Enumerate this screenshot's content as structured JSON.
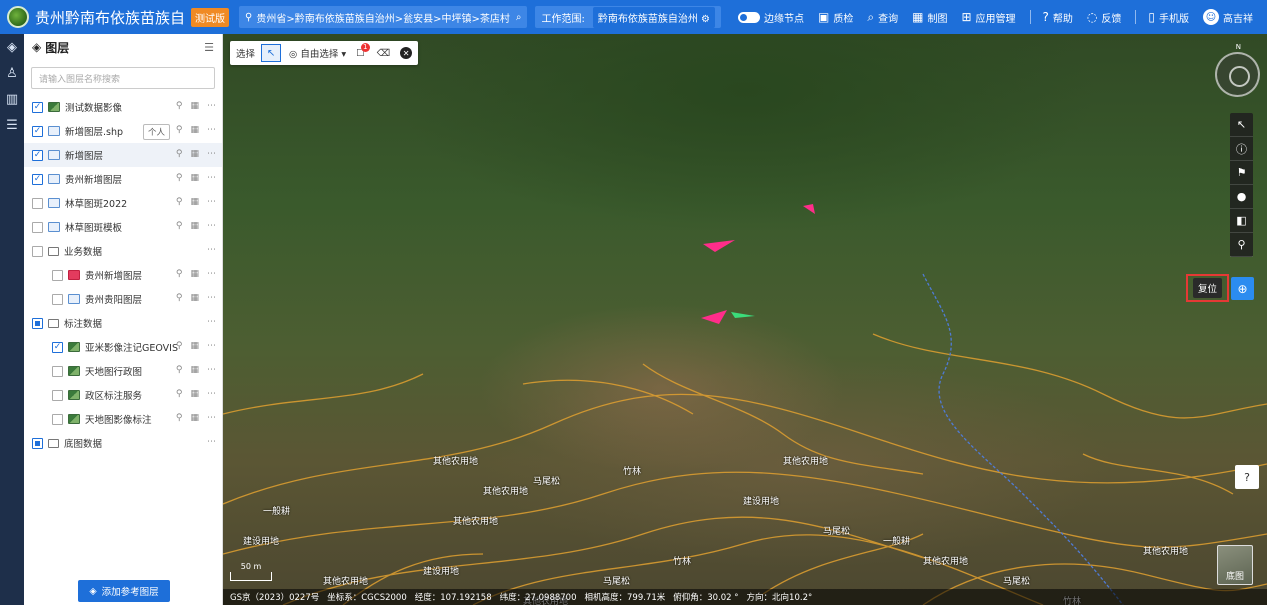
{
  "header": {
    "app_title": "贵州黔南布依族苗族自",
    "version_tag": "测试版",
    "breadcrumb": "贵州省>黔南布依族苗族自治州>瓮安县>中坪镇>茶店村",
    "scope_label": "工作范围:",
    "scope_value": "黔南布依族苗族自治州",
    "nav": [
      {
        "icon": "toggle-icon",
        "label": "边缘节点"
      },
      {
        "icon": "quality-check-icon",
        "label": "质检"
      },
      {
        "icon": "search-icon",
        "label": "查询"
      },
      {
        "icon": "map-draw-icon",
        "label": "制图"
      },
      {
        "icon": "grid-apps-icon",
        "label": "应用管理"
      },
      {
        "icon": "help-icon",
        "label": "帮助"
      },
      {
        "icon": "feedback-icon",
        "label": "反馈"
      },
      {
        "icon": "mobile-icon",
        "label": "手机版"
      }
    ],
    "user_name": "高吉祥"
  },
  "panel": {
    "title": "图层",
    "search_placeholder": "请输入图层名称搜索",
    "personal_badge": "个人",
    "add_button": "添加参考图层",
    "layers": [
      {
        "name": "测试数据影像",
        "checked": true,
        "icon": "image-layer-icon",
        "indent": 0
      },
      {
        "name": "新增图层.shp",
        "checked": true,
        "icon": "vector-layer-icon",
        "indent": 0
      },
      {
        "name": "新增图层",
        "checked": true,
        "icon": "vector-layer-icon",
        "indent": 0
      },
      {
        "name": "贵州新增图层",
        "checked": true,
        "icon": "vector-layer-icon",
        "indent": 0
      },
      {
        "name": "林草图斑2022",
        "checked": false,
        "icon": "vector-layer-icon",
        "indent": 0
      },
      {
        "name": "林草图斑模板",
        "checked": false,
        "icon": "vector-layer-icon",
        "indent": 0
      },
      {
        "name": "业务数据",
        "checked": false,
        "icon": "folder-icon",
        "indent": 0
      },
      {
        "name": "贵州新增图层",
        "checked": false,
        "icon": "red-layer-icon",
        "indent": 1
      },
      {
        "name": "贵州贵阳图层",
        "checked": false,
        "icon": "vector-layer-icon",
        "indent": 1
      },
      {
        "name": "标注数据",
        "checked": "partial",
        "icon": "folder-icon",
        "indent": 0
      },
      {
        "name": "亚米影像注记GEOVIS",
        "checked": true,
        "icon": "image-layer-icon",
        "indent": 1
      },
      {
        "name": "天地图行政图",
        "checked": false,
        "icon": "image-layer-icon",
        "indent": 1
      },
      {
        "name": "政区标注服务",
        "checked": false,
        "icon": "image-layer-icon",
        "indent": 1
      },
      {
        "name": "天地图影像标注",
        "checked": false,
        "icon": "image-layer-icon",
        "indent": 1
      },
      {
        "name": "底图数据",
        "checked": "partial",
        "icon": "folder-icon",
        "indent": 0
      }
    ]
  },
  "map_toolbar": {
    "select_label": "选择",
    "free_select_label": "自由选择",
    "notification_count": "1"
  },
  "map": {
    "reset_label": "复位",
    "basemap_label": "底图",
    "compass_n": "N",
    "scale_label": "50 m",
    "status": {
      "copyright": "GS京（2023）0227号",
      "crs": "坐标系：CGCS2000",
      "lon": "经度：107.192158",
      "lat": "纬度：27.0988700",
      "cam_height": "相机高度：799.71米",
      "pitch": "俯仰角：30.02 °",
      "heading": "方向：北向10.2°"
    },
    "labels": [
      "其他农用地",
      "其他农用地",
      "其他农用地",
      "建设用地",
      "一般耕",
      "马尾松",
      "竹林",
      "建设用地",
      "其他农用地",
      "马尾松",
      "一般耕",
      "其他农用地",
      "竹林",
      "马尾松",
      "其他农用地",
      "建设用地",
      "其他农用地",
      "马尾松",
      "竹林",
      "其他农用地"
    ]
  },
  "colors": {
    "primary": "#1e6fd9",
    "accent_orange": "#f08a24",
    "reset_border": "#e53935",
    "vector_outline": "#e0a030",
    "magenta_feature": "#ff2d8a"
  }
}
